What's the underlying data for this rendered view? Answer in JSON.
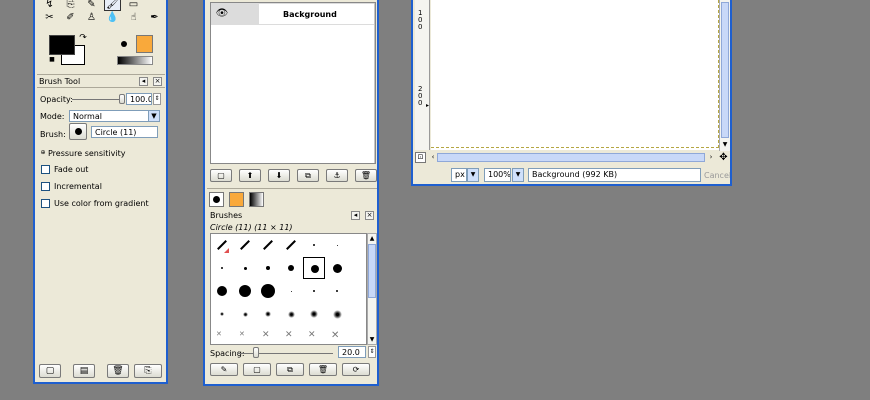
{
  "toolbox": {
    "tool_icons": [
      "path-tool-icon",
      "clone-tool-icon",
      "pencil-tool-icon",
      "paintbrush-tool-icon",
      "eraser-tool-icon",
      "heal-tool-icon",
      "airbrush-tool-icon",
      "ink-tool-icon",
      "blur-tool-icon",
      "smudge-tool-icon",
      "dodge-tool-icon"
    ],
    "fg_color": "#000000",
    "bg_color": "#ffffff",
    "brush_swatch_color": "#f9a93b"
  },
  "tool_options": {
    "title": "Brush Tool",
    "opacity_label": "Opacity:",
    "opacity_value": "100.0",
    "opacity_fraction": 1.0,
    "mode_label": "Mode:",
    "mode_value": "Normal",
    "brush_label": "Brush:",
    "brush_value": "Circle (11)",
    "pressure_label": "Pressure sensitivity",
    "fade_label": "Fade out",
    "incremental_label": "Incremental",
    "gradient_label": "Use color from gradient"
  },
  "layers": {
    "layer_name": "Background",
    "footer_icons": [
      "new-layer-icon",
      "raise-layer-icon",
      "lower-layer-icon",
      "duplicate-layer-icon",
      "anchor-layer-icon",
      "delete-layer-icon"
    ]
  },
  "brushes": {
    "title": "Brushes",
    "selected": "Circle (11) (11 × 11)",
    "spacing_label": "Spacing:",
    "spacing_value": "20.0",
    "spacing_fraction": 0.2,
    "accent": "#f9a93b"
  },
  "image_window": {
    "ruler_top": "100",
    "ruler_mid": "200",
    "unit": "px",
    "zoom": "100%",
    "status": "Background (992 KB)",
    "cancel": "Cancel"
  }
}
